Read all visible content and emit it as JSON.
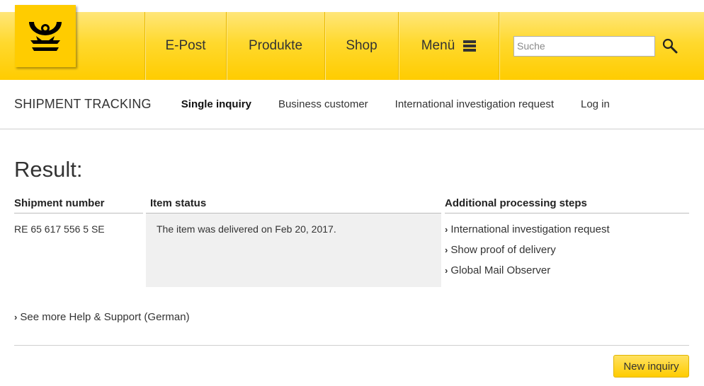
{
  "header": {
    "logo_icon": "posthorn-logo-icon",
    "nav": {
      "epost": "E-Post",
      "produkte": "Produkte",
      "shop": "Shop",
      "menu": "Menü"
    },
    "search": {
      "placeholder": "Suche",
      "value": "",
      "button_icon": "search-icon"
    }
  },
  "subnav": {
    "title": "SHIPMENT TRACKING",
    "tabs": [
      {
        "label": "Single inquiry",
        "active": true
      },
      {
        "label": "Business customer",
        "active": false
      },
      {
        "label": "International investigation request",
        "active": false
      },
      {
        "label": "Log in",
        "active": false
      }
    ]
  },
  "result": {
    "title": "Result:",
    "columns": {
      "shipment": "Shipment number",
      "status": "Item status",
      "steps": "Additional processing steps"
    },
    "shipment_number": "RE 65 617 556 5 SE",
    "status_text": "The item was delivered on Feb 20, 2017.",
    "steps": [
      "International investigation request",
      "Show proof of delivery",
      "Global Mail Observer"
    ],
    "help_link": "See more Help & Support (German)",
    "new_inquiry": "New inquiry"
  },
  "colors": {
    "brand_yellow": "#ffcc00",
    "text": "#333333",
    "status_bg": "#f0f0f0"
  }
}
